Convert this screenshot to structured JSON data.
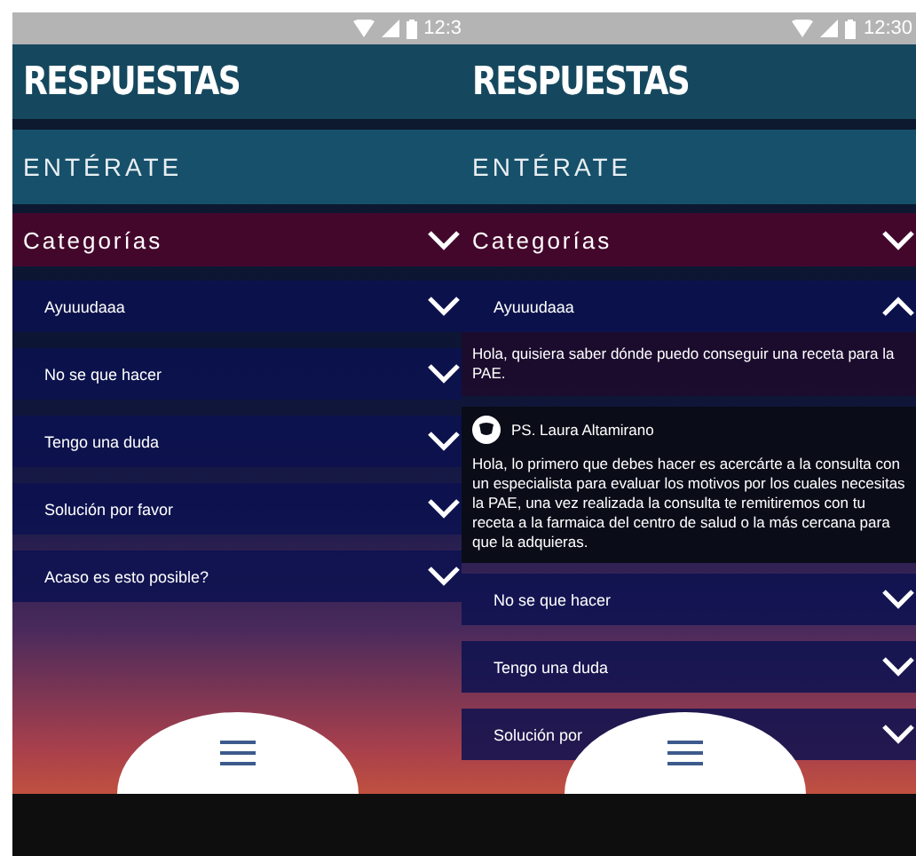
{
  "screens": [
    {
      "status_time": "12:3",
      "title": "RESPUESTAS",
      "section": "ENTÉRATE",
      "category": {
        "label": "Categorías",
        "expanded": false
      },
      "items": [
        {
          "label": "Ayuuudaaa",
          "expanded": false
        },
        {
          "label": "No se que hacer",
          "expanded": false
        },
        {
          "label": "Tengo una duda",
          "expanded": false
        },
        {
          "label": "Solución por favor",
          "expanded": false
        },
        {
          "label": "Acaso es esto posible?",
          "expanded": false
        }
      ]
    },
    {
      "status_time": "12:30",
      "title": "RESPUESTAS",
      "section": "ENTÉRATE",
      "category": {
        "label": "Categorías",
        "expanded": false
      },
      "items": [
        {
          "label": "Ayuuudaaa",
          "expanded": true,
          "question": "Hola, quisiera saber dónde puedo conseguir una receta para la PAE.",
          "answer": {
            "author": "PS. Laura Altamirano",
            "text": "Hola, lo primero que debes hacer es acercárte a la consulta con un especialista para evaluar los motivos por los cuales necesitas la PAE, una vez realizada la consulta te remitiremos con tu receta a la farmaica del centro de salud o la más cercana para que la adquieras."
          }
        },
        {
          "label": "No se que hacer",
          "expanded": false
        },
        {
          "label": "Tengo una duda",
          "expanded": false
        },
        {
          "label": "Solución por",
          "expanded": false
        }
      ]
    }
  ]
}
